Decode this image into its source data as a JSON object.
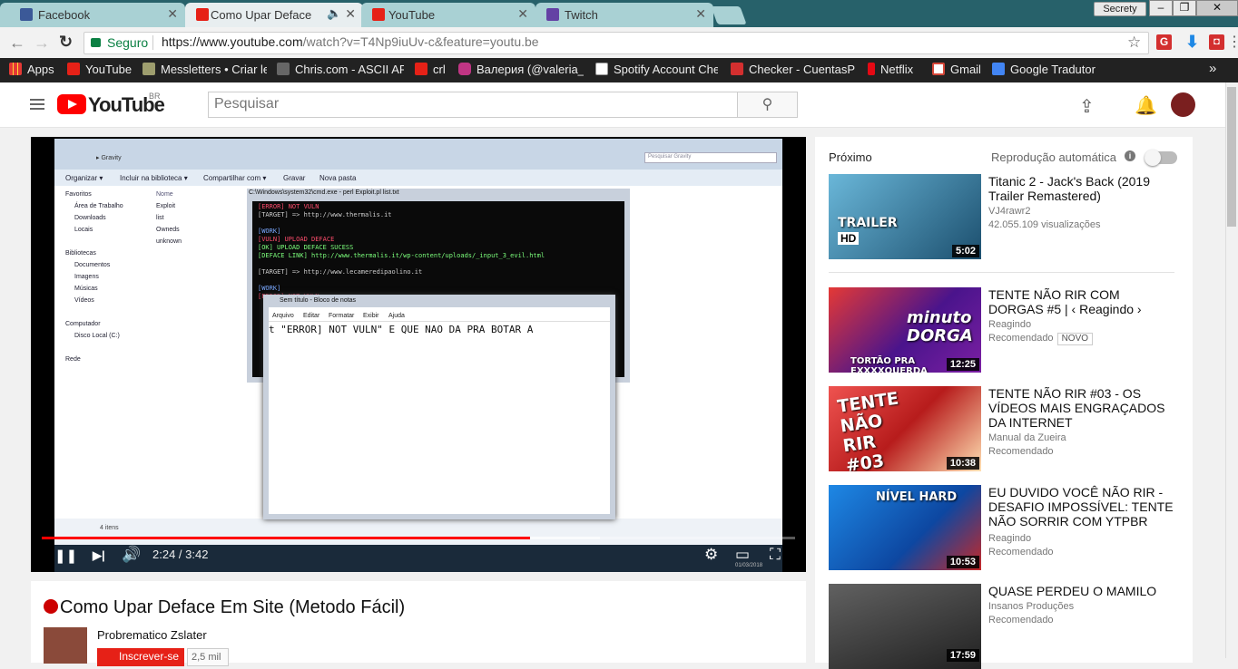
{
  "tabs": [
    {
      "label": "Facebook",
      "color": "#3b5998"
    },
    {
      "label": "Como Upar Deface",
      "color": "#e62117",
      "audio_icon": "speaker-icon"
    },
    {
      "label": "YouTube",
      "color": "#e62117"
    },
    {
      "label": "Twitch",
      "color": "#6441a4"
    }
  ],
  "profile_button": "Secrety",
  "window_controls": {
    "minimize": "–",
    "maximize": "❐",
    "close": "✕"
  },
  "toolbar": {
    "back": "←",
    "forward": "→",
    "reload": "↻",
    "secure_label": "Seguro",
    "url_main": "https://www.youtube.com",
    "url_rest": "/watch?v=T4Np9iuUv-c&feature=youtu.be",
    "star": "☆",
    "ext1": "G",
    "ext2": "⬇",
    "ext3": "◘",
    "menu": "⋮"
  },
  "bookmarks": [
    {
      "label": "Apps",
      "color": "#e0e0e0"
    },
    {
      "label": "YouTube",
      "color": "#e62117"
    },
    {
      "label": "Messletters • Criar let",
      "color": "#9e9e6e"
    },
    {
      "label": "Chris.com - ASCII AR",
      "color": "#555"
    },
    {
      "label": "crl",
      "color": "#e62117"
    },
    {
      "label": "Валерия (@valeria_vi",
      "color": "#c13584"
    },
    {
      "label": "Spotify Account Chec",
      "color": "#eee"
    },
    {
      "label": "Checker - CuentasPre",
      "color": "#d32f2f"
    },
    {
      "label": "Netflix",
      "color": "#e50914"
    },
    {
      "label": "Gmail",
      "color": "#d44638"
    },
    {
      "label": "Google Tradutor",
      "color": "#4285f4"
    }
  ],
  "bookmarks_more": "»",
  "youtube": {
    "logo_text": "YouTube",
    "region": "BR",
    "search_placeholder": "Pesquisar",
    "search_icon": "⚲",
    "upload_icon": "⇪",
    "bell_icon": "🔔"
  },
  "player": {
    "current_time": "2:24",
    "duration": "3:42",
    "time_display": "2:24 / 3:42",
    "progress": 0.6486,
    "buffered": 0.741,
    "play_pause_icon": "❚❚",
    "next_icon": "▶|",
    "volume_icon": "🔊",
    "settings_icon": "⚙",
    "theater_icon": "▭",
    "fullscreen_icon": "⛶"
  },
  "screen_content": {
    "window_path": "▸ Gravity",
    "search_box": "Pesquisar Gravity",
    "explorer_menu": [
      "Organizar ▾",
      "Incluir na biblioteca ▾",
      "Compartilhar com ▾",
      "Gravar",
      "Nova pasta"
    ],
    "nav_pane": [
      "Favoritos",
      "Área de Trabalho",
      "Downloads",
      "Locais",
      "",
      "Bibliotecas",
      "Documentos",
      "Imagens",
      "Músicas",
      "Vídeos",
      "",
      "Computador",
      "Disco Local (C:)",
      "",
      "Rede"
    ],
    "files_header": "Nome",
    "files": [
      "Exploit",
      "list",
      "Owneds",
      "unknown"
    ],
    "status": "4 itens",
    "cmd_title": "C:\\Windows\\system32\\cmd.exe - perl  Exploit.pl list.txt",
    "cmd_lines": [
      "[ERROR] NOT VULN",
      "[TARGET] => http://www.thermalis.it",
      "",
      "[WORK]",
      "[VULN] UPLOAD DEFACE",
      "[OK] UPLOAD DEFACE SUCESS",
      "[DEFACE LINK] http://www.thermalis.it/wp-content/uploads/_input_3_evil.html",
      "",
      "[TARGET] => http://www.lecameredipaolino.it",
      "",
      "[WORK]",
      "[ERROR] NOT VULN"
    ],
    "notepad_title": "Sem título - Bloco de notas",
    "notepad_menu": [
      "Arquivo",
      "Editar",
      "Formatar",
      "Exibir",
      "Ajuda"
    ],
    "notepad_text": "t \"ERROR] NOT VULN\" E QUE NAO DA PRA BOTAR A",
    "taskbar_date": "01/03/2018"
  },
  "video": {
    "title": "Como Upar Deface Em Site (Metodo Fácil)",
    "channel": "Probrematico Zslater",
    "subscribe_label": "Inscrever-se",
    "subscriber_count": "2,5 mil"
  },
  "sidebar": {
    "next_label": "Próximo",
    "autoplay_label": "Reprodução automática",
    "info_icon": "i",
    "autoplay_on": false,
    "items": [
      {
        "title": "Titanic 2 - Jack's Back (2019 Trailer Remastered)",
        "channel": "VJ4rawr2",
        "meta": "42.055.109 visualizações",
        "duration": "5:02",
        "thumb_text": "TRAILER",
        "thumb_badge": "HD",
        "thumb_color": "#3a8ab0"
      },
      {
        "title": "TENTE NÃO RIR COM DORGAS #5 | ‹ Reagindo ›",
        "channel": "Reagindo",
        "meta": "Recomendado",
        "badge": "NOVO",
        "duration": "12:25",
        "thumb_text": "minuto DORGA",
        "thumb_caption": "TORTÃO PRA EXXXXQUERDA",
        "thumb_color": "#6a1b9a"
      },
      {
        "title": "TENTE NÃO RIR #03 - OS VÍDEOS MAIS ENGRAÇADOS DA INTERNET",
        "channel": "Manual da Zueira",
        "meta": "Recomendado",
        "duration": "10:38",
        "thumb_text": "TENTE NÃO RIR #03",
        "thumb_color": "#c62828"
      },
      {
        "title": "EU DUVIDO VOCÊ NÃO RIR - DESAFIO IMPOSSÍVEL: TENTE NÃO SORRIR COM YTPBR",
        "channel": "Reagindo",
        "meta": "Recomendado",
        "duration": "10:53",
        "thumb_text": "NÍVEL HARD",
        "thumb_color": "#1565c0"
      },
      {
        "title": "QUASE PERDEU O MAMILO",
        "channel": "Insanos Produções",
        "meta": "Recomendado",
        "duration": "17:59",
        "thumb_color": "#424242"
      }
    ]
  }
}
